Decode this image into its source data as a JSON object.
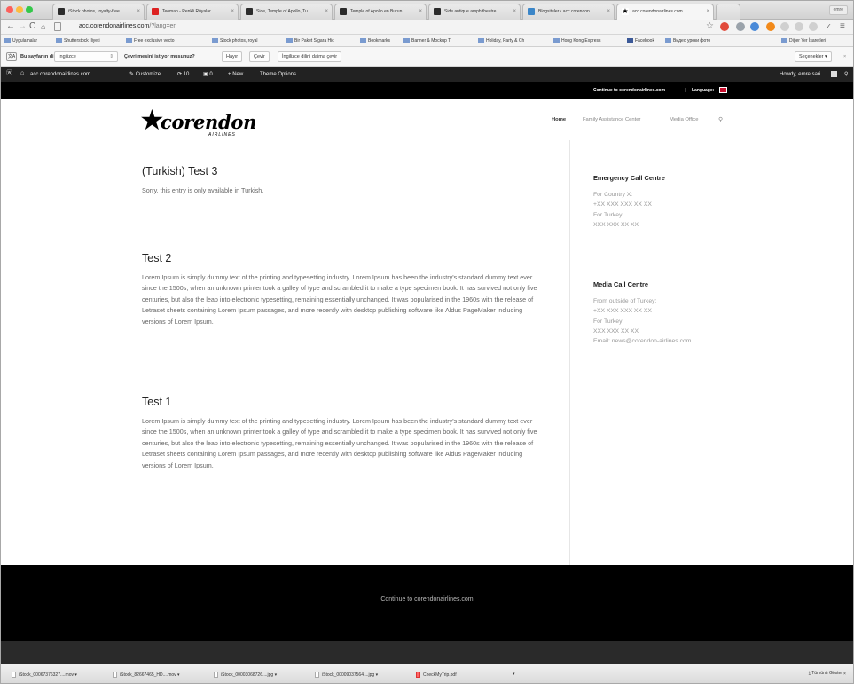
{
  "browser": {
    "tabs": [
      {
        "label": "iStock photos, royalty-free"
      },
      {
        "label": "Teoman - Renkli Rüyalar"
      },
      {
        "label": "Side, Temple of Apollo, Tu"
      },
      {
        "label": "Temple of Apollo en Burun"
      },
      {
        "label": "Side antique amphitheatre"
      },
      {
        "label": "Blogsiteler ‹ acc.corendon"
      },
      {
        "label": "acc.corendonairlines.com"
      }
    ],
    "user": "emre",
    "url": "acc.corendonairlines.com",
    "url_query": "/?lang=en",
    "bookmarks": [
      "Uygulamalar",
      "Shutterstock Iliyeti",
      "Free exclusive vecto",
      "Stock photos, royal",
      "Bir Paket Sigara Hic",
      "Bookmarks",
      "Banner & Mockup T",
      "Holiday, Party & Ch",
      "Hong Kong Express",
      "Facebook",
      "Видео уроки фото",
      "Diğer Yer İşaretleri"
    ],
    "translate": {
      "page_in": "Bu sayfanın dili",
      "language": "İngilizce",
      "question": "Çevrilmesini istiyor musunuz?",
      "no": "Hayır",
      "translate": "Çevir",
      "always": "İngilizce dilini daima çevir",
      "options": "Seçenekler"
    }
  },
  "adminbar": {
    "site": "acc.corendonairlines.com",
    "customize": "Customize",
    "updates": "10",
    "comments": "0",
    "new": "New",
    "theme": "Theme Options",
    "howdy": "Howdy, emre sari"
  },
  "site": {
    "topbar": {
      "continue": "Continue to corendonairlines.com",
      "language": "Language:"
    },
    "logo": {
      "word": "corendon",
      "sub": "AIRLINES"
    },
    "nav": [
      "Home",
      "Family Assistance Center",
      "Media Office"
    ],
    "posts": [
      {
        "title": "(Turkish) Test 3",
        "body": "Sorry, this entry is only available in Turkish."
      },
      {
        "title": "Test 2",
        "body": "Lorem Ipsum is simply dummy text of the printing and typesetting industry. Lorem Ipsum has been the industry's standard dummy text ever since the 1500s, when an unknown printer took a galley of type and scrambled it to make a type specimen book. It has survived not only five centuries, but also the leap into electronic typesetting, remaining essentially unchanged. It was popularised in the 1960s with the release of Letraset sheets containing Lorem Ipsum passages, and more recently with desktop publishing software like Aldus PageMaker including versions of Lorem Ipsum."
      },
      {
        "title": "Test 1",
        "body": "Lorem Ipsum is simply dummy text of the printing and typesetting industry. Lorem Ipsum has been the industry's standard dummy text ever since the 1500s, when an unknown printer took a galley of type and scrambled it to make a type specimen book. It has survived not only five centuries, but also the leap into electronic typesetting, remaining essentially unchanged. It was popularised in the 1960s with the release of Letraset sheets containing Lorem Ipsum passages, and more recently with desktop publishing software like Aldus PageMaker including versions of Lorem Ipsum."
      }
    ],
    "widgets": [
      {
        "title": "Emergency Call Centre",
        "lines": [
          "For Country X:",
          "+XX XXX XXX XX XX",
          "For Turkey:",
          "XXX XXX XX XX"
        ]
      },
      {
        "title": "Media Call Centre",
        "lines": [
          "From outside of Turkey:",
          "+XX XXX XXX XX XX",
          "For Turkey",
          "XXX XXX XX XX",
          "Email: news@corendon-airlines.com"
        ]
      }
    ],
    "footer": "Continue to corendonairlines.com"
  },
  "downloads": {
    "items": [
      "iStock_00067376327....mov",
      "iStock_82667465_HD....mov",
      "iStock_00003068726....jpg",
      "iStock_00009037564....jpg",
      "CheckMyTrip.pdf"
    ],
    "show_all": "Tümünü Göster"
  },
  "colors": {
    "black": "#000000",
    "adminbar": "#222222",
    "accent_red": "#e03131"
  }
}
